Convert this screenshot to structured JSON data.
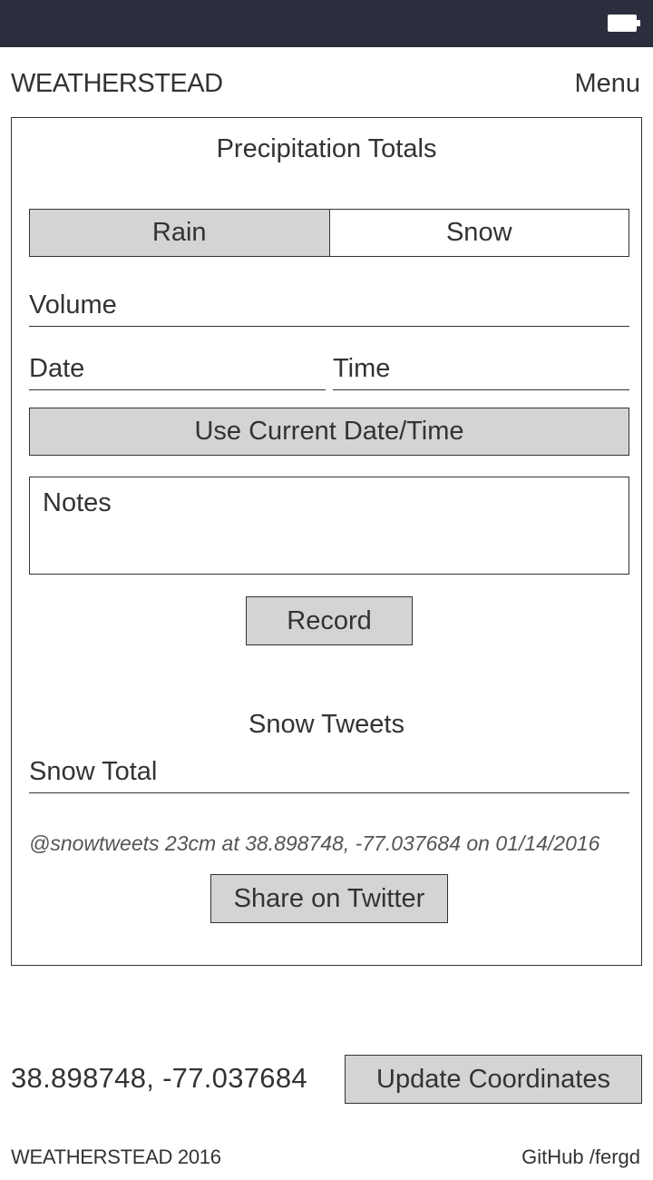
{
  "header": {
    "brand": "WEATHERSTEAD",
    "menu_label": "Menu"
  },
  "precip": {
    "title": "Precipitation Totals",
    "toggle": [
      {
        "label": "Rain",
        "active": true
      },
      {
        "label": "Snow",
        "active": false
      }
    ],
    "volume_placeholder": "Volume",
    "date_placeholder": "Date",
    "time_placeholder": "Time",
    "use_current_label": "Use Current Date/Time",
    "notes_placeholder": "Notes",
    "record_label": "Record"
  },
  "snow_tweets": {
    "title": "Snow Tweets",
    "snow_total_placeholder": "Snow Total",
    "preview": "@snowtweets 23cm at 38.898748, -77.037684 on 01/14/2016",
    "share_label": "Share on Twitter"
  },
  "location": {
    "coords": "38.898748, -77.037684",
    "update_label": "Update Coordinates"
  },
  "footer": {
    "copyright": "WEATHERSTEAD 2016",
    "github": "GitHub /fergd"
  },
  "colors": {
    "statusbar": "#2b2f3d",
    "button_fill": "#d4d4d4",
    "border": "#333333"
  }
}
